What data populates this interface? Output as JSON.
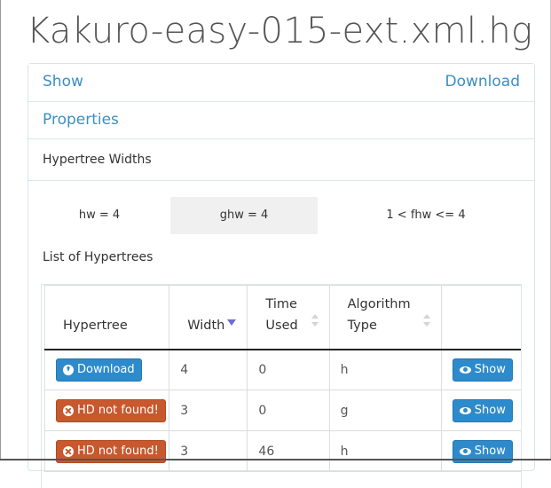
{
  "page": {
    "title": "Kakuro-easy-015-ext.xml.hg"
  },
  "panel": {
    "show_label": "Show",
    "download_label": "Download",
    "properties_label": "Properties",
    "hypertree_widths_label": "Hypertree Widths",
    "list_label": "List of Hypertrees"
  },
  "widths": {
    "hw": "hw = 4",
    "ghw": "ghw = 4",
    "fhw": "1 < fhw <= 4"
  },
  "table": {
    "headers": {
      "hypertree": "Hypertree",
      "width": "Width",
      "time": "Time Used",
      "algorithm": "Algorithm Type"
    },
    "rows": [
      {
        "hypertree": "Download",
        "hypertree_icon": "download-icon",
        "width": "4",
        "time": "0",
        "algorithm": "h",
        "action": "Show"
      },
      {
        "hypertree": "HD not found!",
        "hypertree_icon": "x-circle-icon",
        "width": "3",
        "time": "0",
        "algorithm": "g",
        "action": "Show"
      },
      {
        "hypertree": "HD not found!",
        "hypertree_icon": "x-circle-icon",
        "width": "3",
        "time": "46",
        "algorithm": "h",
        "action": "Show"
      }
    ]
  },
  "colors": {
    "link": "#3a8fc3",
    "button_blue": "#2e8bcb",
    "button_red": "#c8582d",
    "sort_active": "#6c6cd6"
  }
}
